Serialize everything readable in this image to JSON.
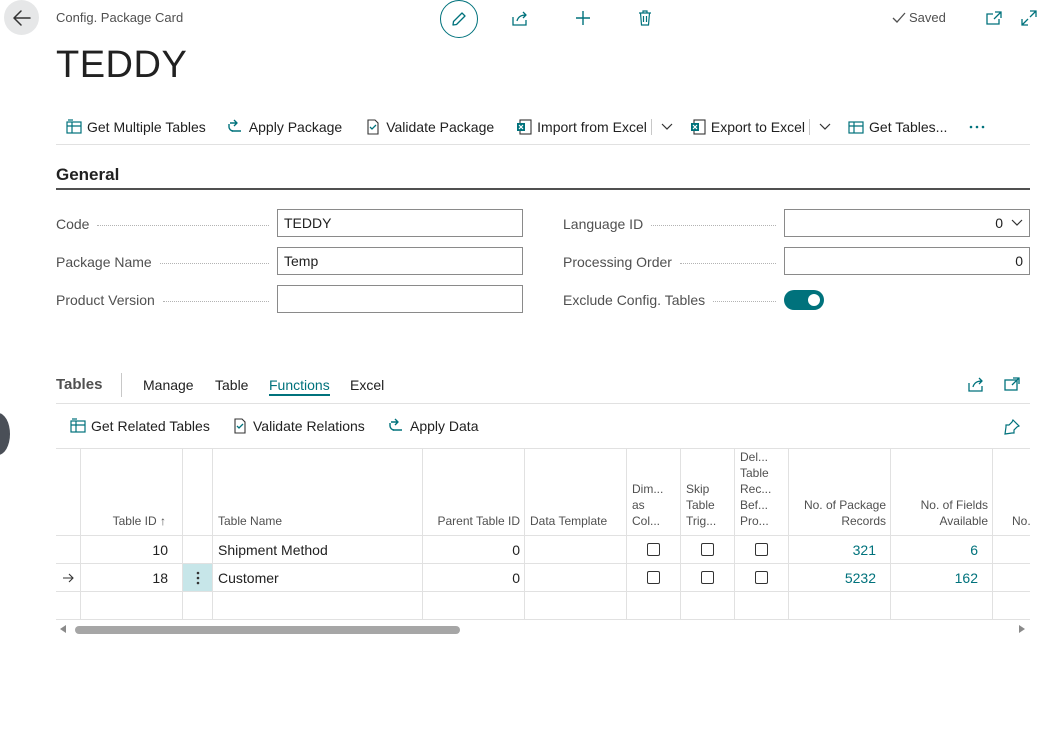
{
  "header": {
    "breadcrumb": "Config. Package Card",
    "saved_label": "Saved",
    "title": "TEDDY"
  },
  "actions": [
    {
      "label": "Get Multiple Tables",
      "icon": "get-multiple-tables-icon"
    },
    {
      "label": "Apply Package",
      "icon": "apply-package-icon"
    },
    {
      "label": "Validate Package",
      "icon": "validate-package-icon"
    },
    {
      "label": "Import from Excel",
      "icon": "import-excel-icon"
    },
    {
      "label": "Export to Excel",
      "icon": "export-excel-icon"
    },
    {
      "label": "Get Tables...",
      "icon": "get-tables-icon"
    }
  ],
  "general": {
    "title": "General",
    "code_label": "Code",
    "code_value": "TEDDY",
    "package_name_label": "Package Name",
    "package_name_value": "Temp",
    "product_version_label": "Product Version",
    "product_version_value": "",
    "language_id_label": "Language ID",
    "language_id_value": "0",
    "processing_order_label": "Processing Order",
    "processing_order_value": "0",
    "exclude_config_label": "Exclude Config. Tables",
    "exclude_config_value": true
  },
  "tables": {
    "title": "Tables",
    "tabs": [
      "Manage",
      "Table",
      "Functions",
      "Excel"
    ],
    "active_tab": "Functions",
    "functions": [
      {
        "label": "Get Related Tables",
        "icon": "get-related-tables-icon"
      },
      {
        "label": "Validate Relations",
        "icon": "validate-relations-icon"
      },
      {
        "label": "Apply Data",
        "icon": "apply-data-icon"
      }
    ],
    "columns": {
      "table_id": "Table ID",
      "sort_indicator": "↑",
      "table_name": "Table Name",
      "parent_table_id": "Parent Table ID",
      "data_template": "Data Template",
      "dim_as_col": [
        "Dim...",
        "as",
        "Col..."
      ],
      "skip_table_trig": [
        "Skip",
        "Table",
        "Trig..."
      ],
      "del_table_rec": [
        "Del...",
        "Table",
        "Rec...",
        "Bef...",
        "Pro..."
      ],
      "no_package_records": [
        "No. of Package",
        "Records"
      ],
      "no_fields_available": [
        "No. of Fields",
        "Available"
      ],
      "no_more": "No."
    },
    "rows": [
      {
        "table_id": "10",
        "table_name": "Shipment Method",
        "parent_table_id": "0",
        "data_template": "",
        "dim": false,
        "skip": false,
        "del": false,
        "package_records": "321",
        "fields_available": "6",
        "current": false
      },
      {
        "table_id": "18",
        "table_name": "Customer",
        "parent_table_id": "0",
        "data_template": "",
        "dim": false,
        "skip": false,
        "del": false,
        "package_records": "5232",
        "fields_available": "162",
        "current": true
      }
    ]
  },
  "colors": {
    "accent": "#00727c",
    "text": "#212121",
    "muted": "#505050",
    "border": "#e1e1e1",
    "selected_cell": "#c7e6e9"
  }
}
